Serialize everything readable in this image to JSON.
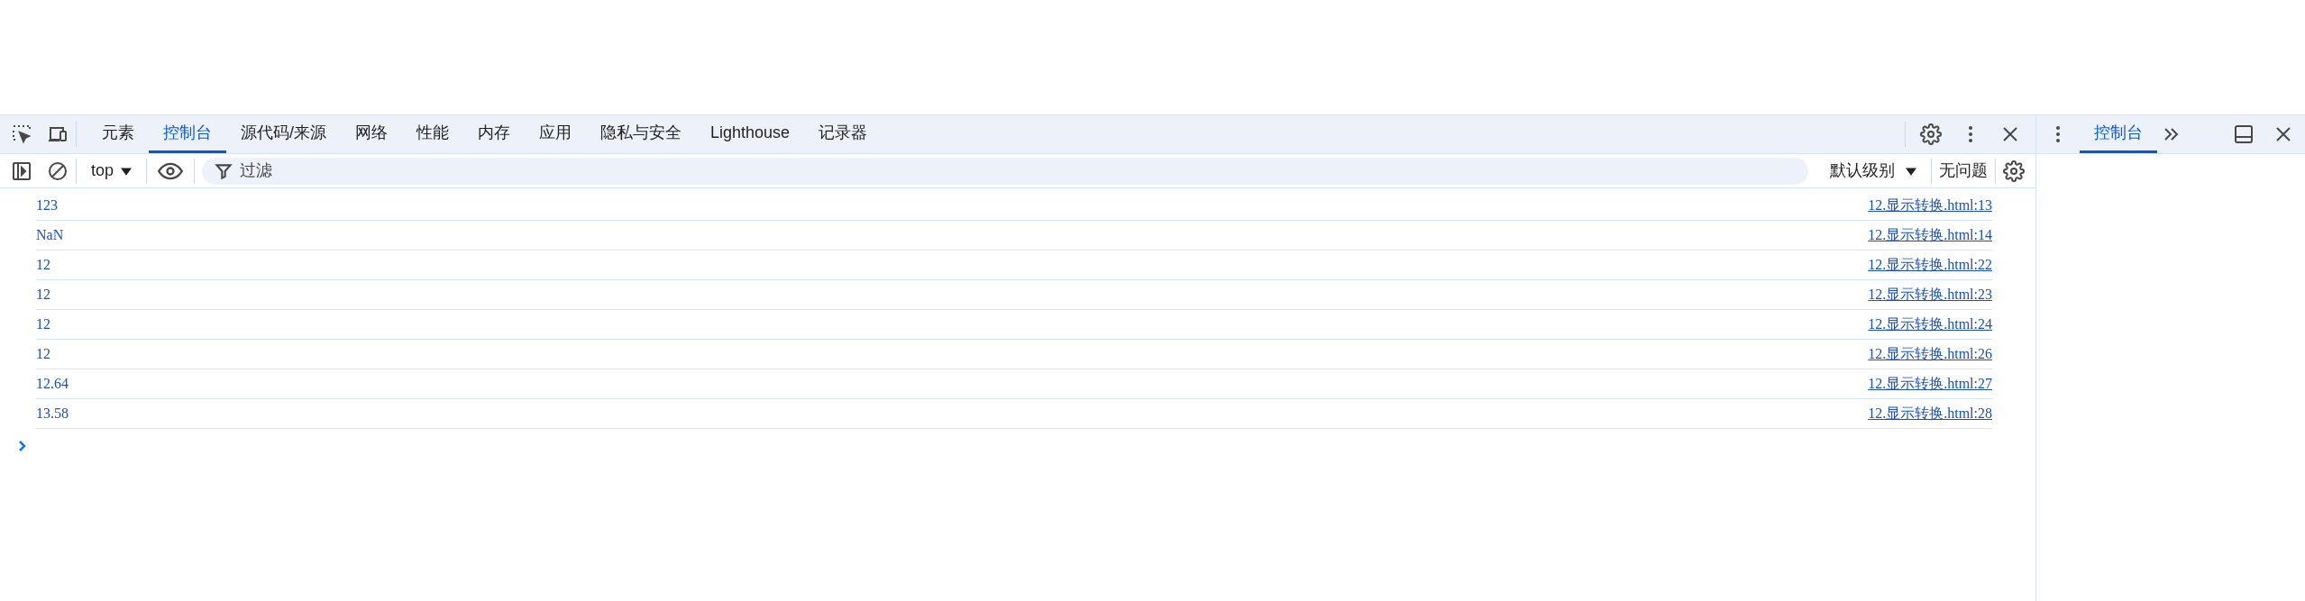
{
  "main_toolbar": {
    "tabs": [
      {
        "label": "元素",
        "selected": false
      },
      {
        "label": "控制台",
        "selected": true
      },
      {
        "label": "源代码/来源",
        "selected": false
      },
      {
        "label": "网络",
        "selected": false
      },
      {
        "label": "性能",
        "selected": false
      },
      {
        "label": "内存",
        "selected": false
      },
      {
        "label": "应用",
        "selected": false
      },
      {
        "label": "隐私与安全",
        "selected": false
      },
      {
        "label": "Lighthouse",
        "selected": false
      },
      {
        "label": "记录器",
        "selected": false
      }
    ]
  },
  "console_toolbar": {
    "context": "top",
    "filter": {
      "placeholder": "过滤"
    },
    "levels": "默认级别",
    "issues": "无问题"
  },
  "messages": [
    {
      "value": "123",
      "source": "12.显示转换.html:13"
    },
    {
      "value": "NaN",
      "source": "12.显示转换.html:14"
    },
    {
      "value": "12",
      "source": "12.显示转换.html:22"
    },
    {
      "value": "12",
      "source": "12.显示转换.html:23"
    },
    {
      "value": "12",
      "source": "12.显示转换.html:24"
    },
    {
      "value": "12",
      "source": "12.显示转换.html:26"
    },
    {
      "value": "12.64",
      "source": "12.显示转换.html:27"
    },
    {
      "value": "13.58",
      "source": "12.显示转换.html:28"
    }
  ],
  "drawer": {
    "tabs": [
      {
        "label": "控制台",
        "selected": true
      }
    ]
  }
}
